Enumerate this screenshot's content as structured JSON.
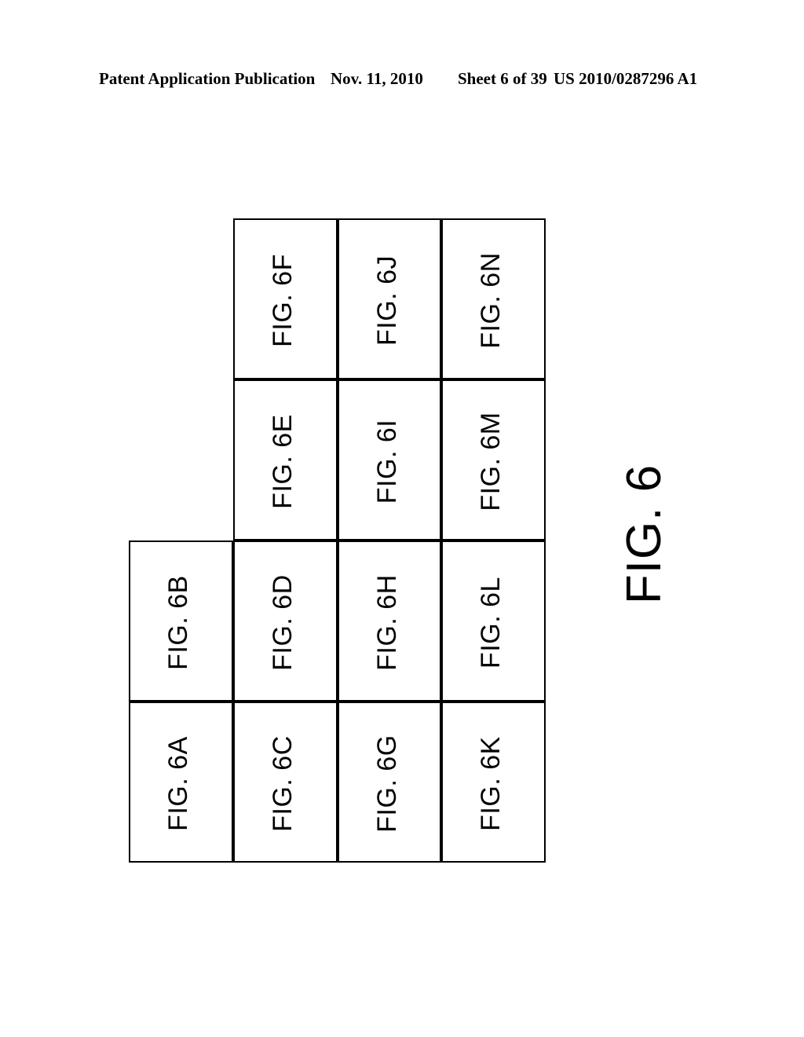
{
  "header": {
    "publication": "Patent Application Publication",
    "date": "Nov. 11, 2010",
    "sheet": "Sheet 6 of 39",
    "patent_number": "US 2010/0287296 A1"
  },
  "figure": {
    "title": "FIG. 6",
    "grid": {
      "columns": 4,
      "rows": 4,
      "cells": [
        {
          "label": "FIG. 6A",
          "col": 0,
          "row": 3
        },
        {
          "label": "FIG. 6B",
          "col": 0,
          "row": 2
        },
        {
          "label": "FIG. 6C",
          "col": 1,
          "row": 3
        },
        {
          "label": "FIG. 6D",
          "col": 1,
          "row": 2
        },
        {
          "label": "FIG. 6E",
          "col": 1,
          "row": 1
        },
        {
          "label": "FIG. 6F",
          "col": 1,
          "row": 0
        },
        {
          "label": "FIG. 6G",
          "col": 2,
          "row": 3
        },
        {
          "label": "FIG. 6H",
          "col": 2,
          "row": 2
        },
        {
          "label": "FIG. 6I",
          "col": 2,
          "row": 1
        },
        {
          "label": "FIG. 6J",
          "col": 2,
          "row": 0
        },
        {
          "label": "FIG. 6K",
          "col": 3,
          "row": 3
        },
        {
          "label": "FIG. 6L",
          "col": 3,
          "row": 2
        },
        {
          "label": "FIG. 6M",
          "col": 3,
          "row": 1
        },
        {
          "label": "FIG. 6N",
          "col": 3,
          "row": 0
        }
      ]
    }
  },
  "colors": {
    "ink": "#000000",
    "paper": "#ffffff"
  }
}
